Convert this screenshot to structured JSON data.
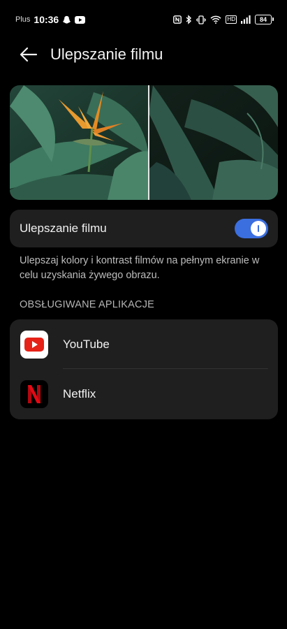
{
  "status_bar": {
    "carrier": "Plus",
    "time": "10:36",
    "network_badge": "HD",
    "battery": "84"
  },
  "header": {
    "title": "Ulepszanie filmu"
  },
  "toggle": {
    "label": "Ulepszanie filmu",
    "enabled": true
  },
  "description": "Ulepszaj kolory i kontrast filmów na pełnym ekranie w celu uzyskania żywego obrazu.",
  "section": {
    "title": "OBSŁUGIWANE APLIKACJE"
  },
  "apps": [
    {
      "name": "YouTube",
      "icon": "youtube-icon"
    },
    {
      "name": "Netflix",
      "icon": "netflix-icon"
    }
  ],
  "colors": {
    "accent": "#3b6fe0",
    "card": "#1f1f1f",
    "background": "#000000"
  }
}
